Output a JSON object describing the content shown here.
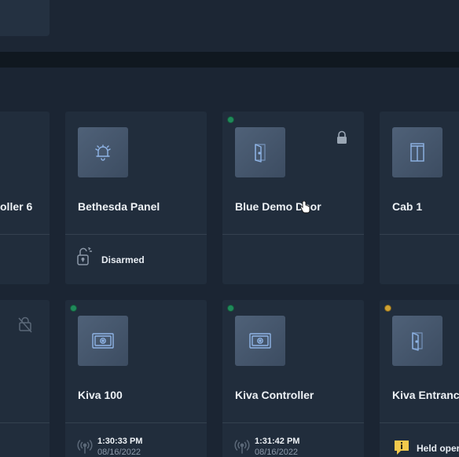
{
  "colors": {
    "background": "#1b2533",
    "card": "#212d3c",
    "icon_tile": "#4a5c73",
    "icon_stroke": "#8fb4e6",
    "status_green": "#1f8a5a",
    "status_yellow": "#d0a232",
    "warning_badge": "#f2c94c"
  },
  "cards_row1": [
    {
      "title": "oller 6",
      "icon": "partial-card"
    },
    {
      "title": "Bethesda Panel",
      "icon": "alarm-bell-icon",
      "status": "Disarmed",
      "status_icon": "unlock-icon"
    },
    {
      "title": "Blue Demo Door",
      "icon": "door-icon",
      "online": "green",
      "lock_icon": "lock-icon"
    },
    {
      "title": "Cab 1",
      "icon": "elevator-door-icon"
    }
  ],
  "cards_row2": [
    {
      "title": "",
      "icon": "lock-disabled-icon"
    },
    {
      "title": "Kiva 100",
      "icon": "camera-reader-icon",
      "online": "green",
      "last_time": "1:30:33 PM",
      "last_date": "08/16/2022"
    },
    {
      "title": "Kiva Controller",
      "icon": "camera-reader-icon",
      "online": "green",
      "last_time": "1:31:42 PM",
      "last_date": "08/16/2022"
    },
    {
      "title": "Kiva Entranc",
      "icon": "door-icon",
      "online": "yellow",
      "status": "Held oper",
      "status_icon": "warning-badge-icon"
    }
  ]
}
